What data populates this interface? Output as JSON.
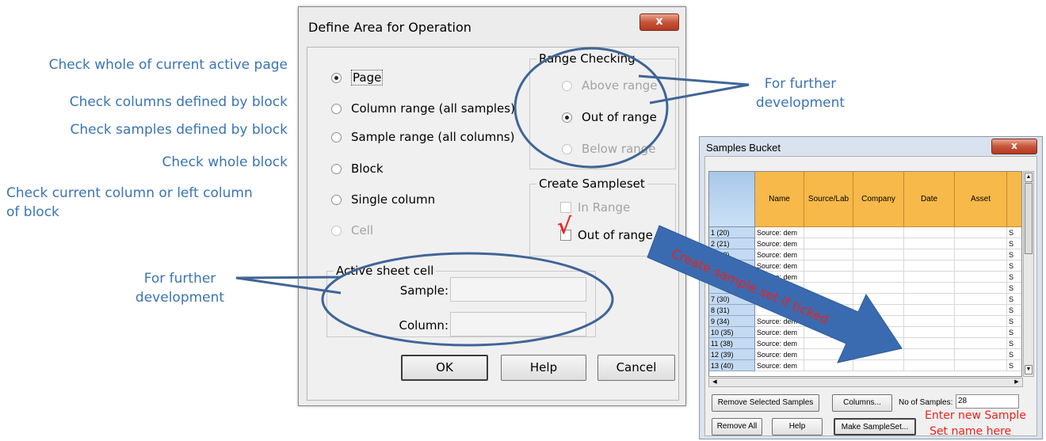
{
  "annotations": {
    "left": [
      "Check whole of current active page",
      "Check columns defined by block",
      "Check samples defined by block",
      "Check whole block",
      "Check current column or left column",
      "of block"
    ],
    "further_dev_left": [
      "For further",
      "development"
    ],
    "further_dev_right": [
      "For further",
      "development"
    ],
    "arrow_text": "Create sample set if ticked",
    "enter_name": [
      "Enter new Sample",
      "Set name here"
    ]
  },
  "dialog": {
    "title": "Define Area for Operation",
    "close_glyph": "x",
    "options": [
      {
        "label": "Page",
        "checked": true,
        "disabled": false
      },
      {
        "label": "Column range (all samples)",
        "checked": false,
        "disabled": false
      },
      {
        "label": "Sample range (all columns)",
        "checked": false,
        "disabled": false
      },
      {
        "label": "Block",
        "checked": false,
        "disabled": false
      },
      {
        "label": "Single column",
        "checked": false,
        "disabled": false
      },
      {
        "label": "Cell",
        "checked": false,
        "disabled": true
      }
    ],
    "range_checking": {
      "label": "Range Checking",
      "options": [
        {
          "label": "Above range",
          "checked": false,
          "disabled": true
        },
        {
          "label": "Out of range",
          "checked": true,
          "disabled": false
        },
        {
          "label": "Below range",
          "checked": false,
          "disabled": true
        }
      ]
    },
    "create_sampleset": {
      "label": "Create Sampleset",
      "in_range": "In Range",
      "out_of_range": "Out of range",
      "tick_mark": "√"
    },
    "active_cell": {
      "label": "Active sheet  cell",
      "sample_label": "Sample:",
      "column_label": "Column:",
      "sample_value": "",
      "column_value": ""
    },
    "buttons": {
      "ok": "OK",
      "help": "Help",
      "cancel": "Cancel"
    }
  },
  "samples_bucket": {
    "title": "Samples Bucket",
    "close_glyph": "x",
    "columns": [
      "Name",
      "Source/Lab",
      "Company",
      "Date",
      "Asset",
      ""
    ],
    "rows": [
      {
        "id": "1 (20)",
        "name": "Source: dem",
        "last": "S"
      },
      {
        "id": "2 (21)",
        "name": "Source: dem",
        "last": "S"
      },
      {
        "id": "3 (22)",
        "name": "Source: dem",
        "last": "S"
      },
      {
        "id": "",
        "name": "Source: dem",
        "last": "S"
      },
      {
        "id": "",
        "name": "Source: dem",
        "last": "S"
      },
      {
        "id": "",
        "name": "",
        "last": "S"
      },
      {
        "id": "7 (30)",
        "name": "",
        "last": "S"
      },
      {
        "id": "8 (31)",
        "name": "",
        "last": "S"
      },
      {
        "id": "9 (34)",
        "name": "Source: dem",
        "last": "S"
      },
      {
        "id": "10 (35)",
        "name": "Source: dem",
        "last": "S"
      },
      {
        "id": "11 (38)",
        "name": "Source: dem",
        "last": "S"
      },
      {
        "id": "12 (39)",
        "name": "Source: dem",
        "last": "S"
      },
      {
        "id": "13 (40)",
        "name": "Source: dem",
        "last": "S"
      }
    ],
    "remove_selected": "Remove Selected Samples",
    "columns_btn": "Columns...",
    "no_samples_label": "No of Samples:",
    "no_samples_value": "28",
    "remove_all": "Remove All",
    "help": "Help",
    "make_sampleset": "Make SampleSet..."
  }
}
